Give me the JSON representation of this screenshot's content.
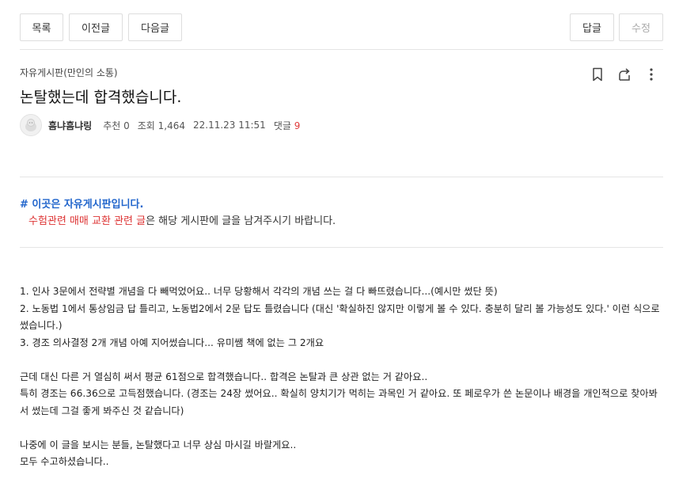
{
  "toolbar": {
    "list": "목록",
    "prev": "이전글",
    "next": "다음글",
    "reply": "답글",
    "edit": "수정"
  },
  "post": {
    "board": "자유게시판(만인의 소통)",
    "title": "논탈했는데 합격했습니다.",
    "author": "흠냐흠냐링",
    "recommend": "추천 0",
    "views": "조회 1,464",
    "date": "22.11.23 11:51",
    "comments_label": "댓글",
    "comments_count": "9"
  },
  "icons": {
    "bookmark": "bookmark-icon",
    "share": "share-icon",
    "more": "more-vertical-icon",
    "avatar": "avatar-icon"
  },
  "notice": {
    "title": "# 이곳은 자유게시판입니다.",
    "red": "수험관련 매매 교환 관련 글",
    "rest": "은 해당 게시판에 글을 남겨주시기 바랍니다."
  },
  "body": {
    "l1": "1. 인사 3문에서 전략별 개념을 다 빼먹었어요.. 너무 당황해서 각각의 개념 쓰는 걸 다 빠뜨렸습니다...(예시만 썼단 뜻)",
    "l2": "2. 노동법 1에서 통상임금 답 틀리고, 노동법2에서 2문 답도 틀렸습니다 (대신 '확실하진 않지만 이렇게 볼 수 있다. 충분히 달리 볼 가능성도 있다.' 이런 식으로 썼습니다.)",
    "l3": "3. 경조 의사결정 2개 개념 아예 지어썼습니다... 유미쌤 책에 없는 그 2개요",
    "l4": "근데 대신 다른 거 열심히 써서 평균 61점으로 합격했습니다.. 합격은 논탈과 큰 상관 없는 거 같아요..",
    "l5": "특히 경조는 66.36으로 고득점했습니다. (경조는 24장 썼어요.. 확실히 양치기가 먹히는 과목인 거 같아요. 또 페로우가 쓴 논문이나 배경을 개인적으로 찾아봐서 썼는데 그걸 좋게 봐주신 것 같습니다)",
    "l6": "나중에 이 글을 보시는 분들, 논탈했다고 너무 상심 마시길 바랄게요..",
    "l7": "모두 수고하셨습니다.."
  }
}
